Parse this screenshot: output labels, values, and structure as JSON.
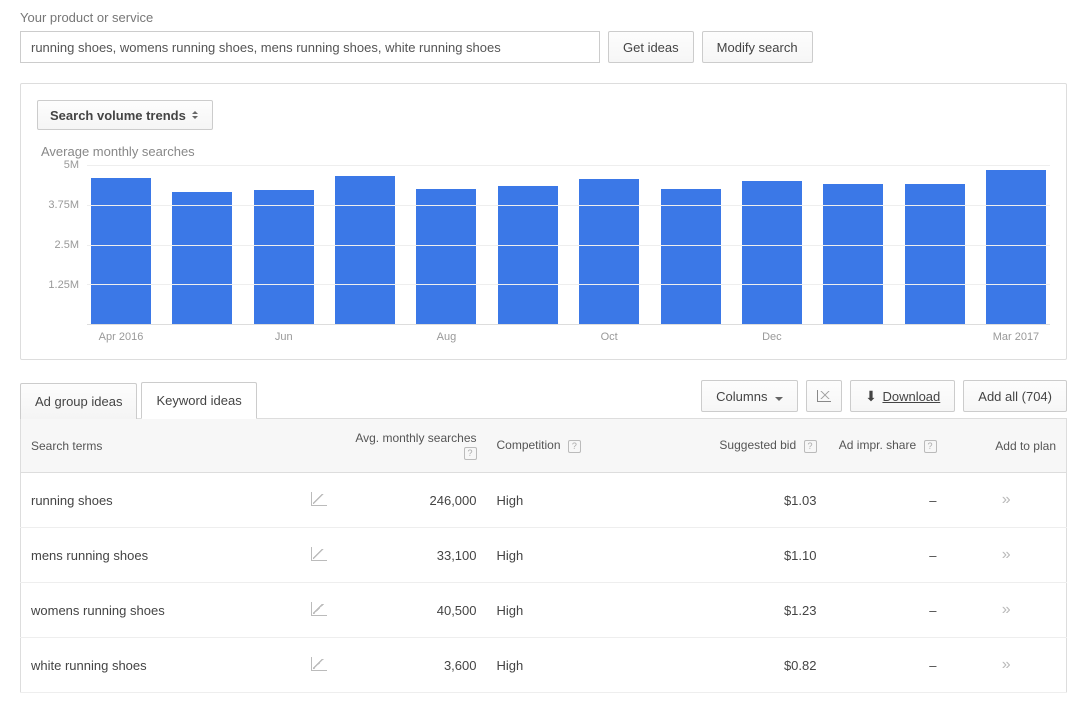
{
  "header": {
    "label": "Your product or service",
    "input_value": "running shoes, womens running shoes, mens running shoes, white running shoes",
    "get_ideas_label": "Get ideas",
    "modify_search_label": "Modify search"
  },
  "chart": {
    "dropdown_label": "Search volume trends",
    "subtitle": "Average monthly searches"
  },
  "chart_data": {
    "type": "bar",
    "title": "Average monthly searches",
    "ylabel": "",
    "xlabel": "",
    "ylim": [
      0,
      5000000
    ],
    "y_ticks": [
      "5M",
      "3.75M",
      "2.5M",
      "1.25M"
    ],
    "x_tick_labels": [
      "Apr 2016",
      "",
      "Jun",
      "",
      "Aug",
      "",
      "Oct",
      "",
      "Dec",
      "",
      "",
      "Mar 2017"
    ],
    "categories": [
      "Apr 2016",
      "May 2016",
      "Jun 2016",
      "Jul 2016",
      "Aug 2016",
      "Sep 2016",
      "Oct 2016",
      "Nov 2016",
      "Dec 2016",
      "Jan 2017",
      "Feb 2017",
      "Mar 2017"
    ],
    "values": [
      4600000,
      4150000,
      4200000,
      4650000,
      4250000,
      4350000,
      4550000,
      4250000,
      4500000,
      4400000,
      4400000,
      4850000
    ]
  },
  "tabs": {
    "ad_group": "Ad group ideas",
    "keyword": "Keyword ideas"
  },
  "toolbar": {
    "columns_label": "Columns",
    "download_label": "Download",
    "add_all_label": "Add all (704)"
  },
  "table": {
    "headers": {
      "search_terms": "Search terms",
      "avg_searches": "Avg. monthly searches",
      "competition": "Competition",
      "suggested_bid": "Suggested bid",
      "ad_impr_share": "Ad impr. share",
      "add_to_plan": "Add to plan"
    },
    "rows": [
      {
        "term": "running shoes",
        "searches": "246,000",
        "competition": "High",
        "bid": "$1.03",
        "impr": "–"
      },
      {
        "term": "mens running shoes",
        "searches": "33,100",
        "competition": "High",
        "bid": "$1.10",
        "impr": "–"
      },
      {
        "term": "womens running shoes",
        "searches": "40,500",
        "competition": "High",
        "bid": "$1.23",
        "impr": "–"
      },
      {
        "term": "white running shoes",
        "searches": "3,600",
        "competition": "High",
        "bid": "$0.82",
        "impr": "–"
      }
    ]
  }
}
